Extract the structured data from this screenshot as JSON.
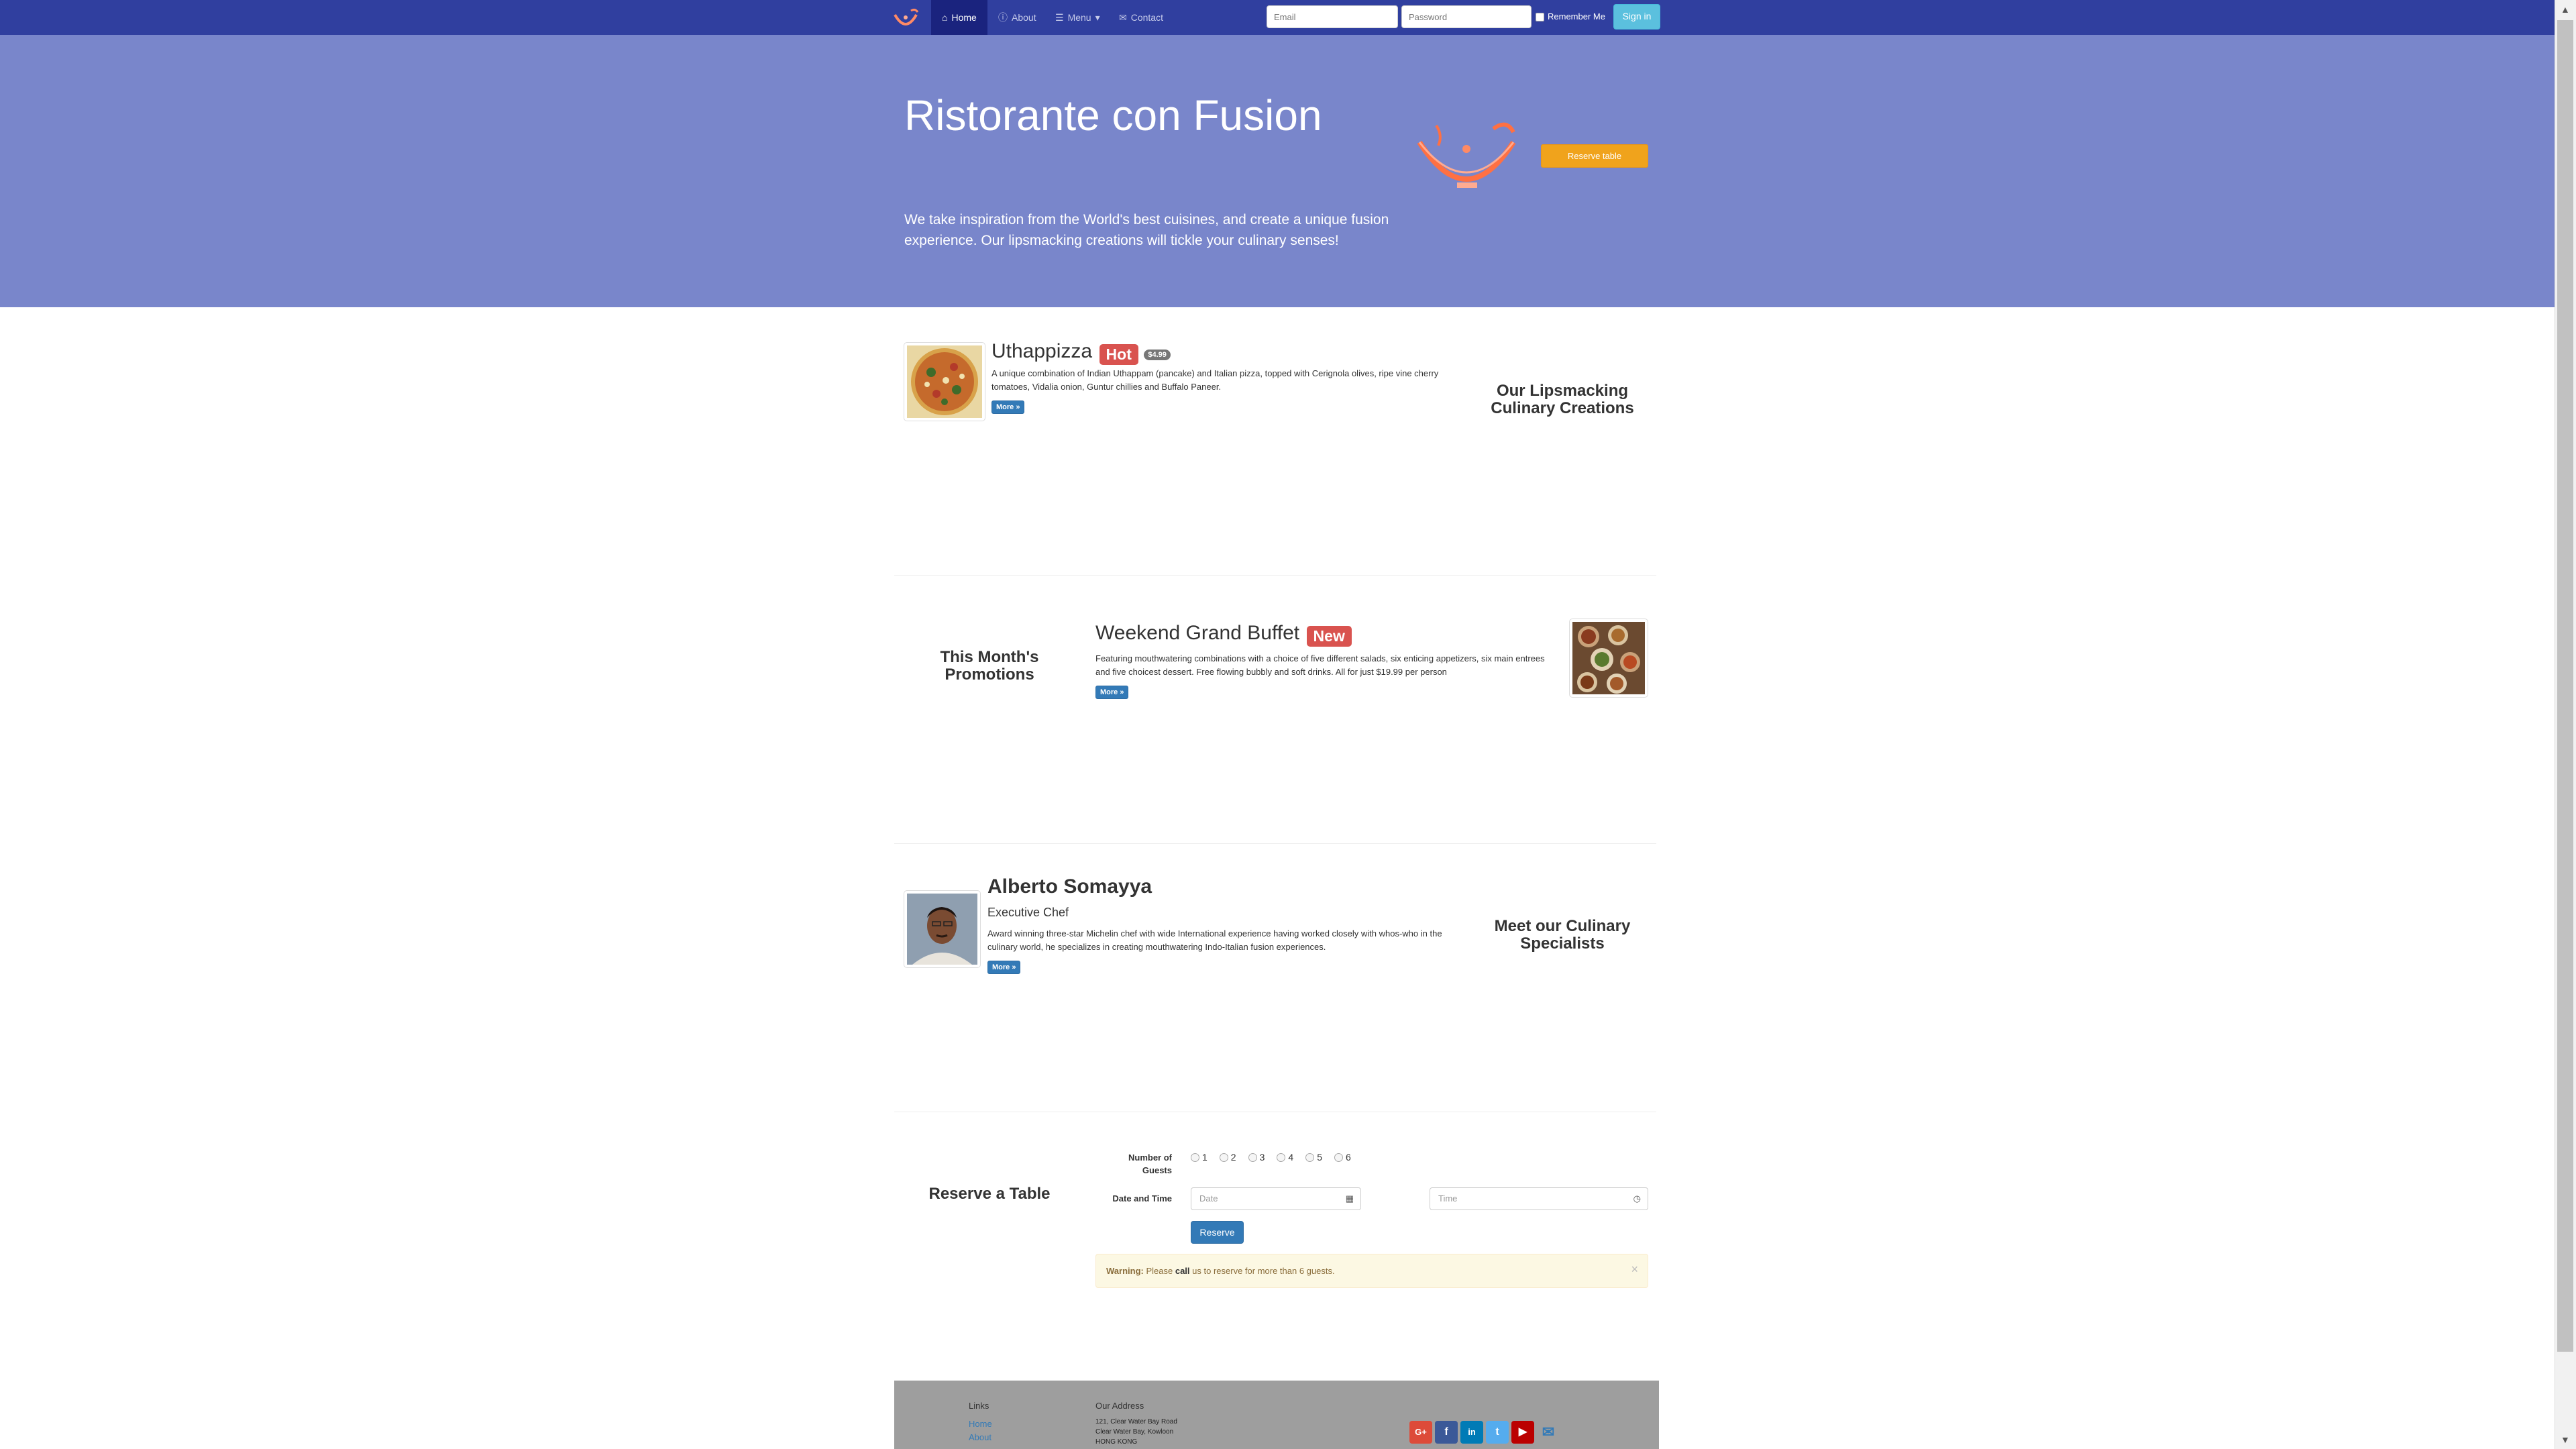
{
  "navbar": {
    "home": "Home",
    "about": "About",
    "menu": "Menu",
    "contact": "Contact",
    "email_placeholder": "Email",
    "password_placeholder": "Password",
    "remember_me": "Remember Me",
    "sign_in": "Sign in"
  },
  "jumbotron": {
    "title": "Ristorante con Fusion",
    "text": "We take inspiration from the World's best cuisines, and create a unique fusion experience. Our lipsmacking creations will tickle your culinary senses!",
    "reserve_button": "Reserve table"
  },
  "dish": {
    "name": "Uthappizza",
    "label": "Hot",
    "price": "$4.99",
    "description": "A unique combination of Indian Uthappam (pancake) and Italian pizza, topped with Cerignola olives, ripe vine cherry tomatoes, Vidalia onion, Guntur chillies and Buffalo Paneer.",
    "more": "More »",
    "side_heading": "Our Lipsmacking Culinary Creations"
  },
  "promotion": {
    "name": "Weekend Grand Buffet",
    "label": "New",
    "description": "Featuring mouthwatering combinations with a choice of five different salads, six enticing appetizers, six main entrees and five choicest dessert. Free flowing bubbly and soft drinks. All for just $19.99 per person",
    "more": "More »",
    "side_heading": "This Month's Promotions"
  },
  "leader": {
    "name": "Alberto Somayya",
    "designation": "Executive Chef",
    "description": "Award winning three-star Michelin chef with wide International experience having worked closely with whos-who in the culinary world, he specializes in creating mouthwatering Indo-Italian fusion experiences.",
    "more": "More »",
    "side_heading": "Meet our Culinary Specialists"
  },
  "reservation": {
    "heading": "Reserve a Table",
    "guests_label": "Number of Guests",
    "guest_options": [
      "1",
      "2",
      "3",
      "4",
      "5",
      "6"
    ],
    "datetime_label": "Date and Time",
    "date_placeholder": "Date",
    "time_placeholder": "Time",
    "reserve_button": "Reserve",
    "warning_strong": "Warning:",
    "warning_text_1": "Please",
    "warning_call": "call",
    "warning_text_2": "us to reserve for more than 6 guests.",
    "close_symbol": "×"
  },
  "footer": {
    "links_heading": "Links",
    "links": [
      "Home",
      "About"
    ],
    "address_heading": "Our Address",
    "address_lines": [
      "121, Clear Water Bay Road",
      "Clear Water Bay, Kowloon",
      "HONG KONG"
    ],
    "social_icons": [
      "google-plus-icon",
      "facebook-icon",
      "linkedin-icon",
      "twitter-icon",
      "youtube-icon",
      "email-icon"
    ]
  },
  "colors": {
    "navbar": "#303f9f",
    "navbar_active": "#1a237e",
    "jumbotron": "#7986cb",
    "reserve_table_button": "#f0a31c",
    "primary_button": "#337ab7",
    "label_danger": "#d9534f",
    "footer": "#9e9e9e"
  }
}
